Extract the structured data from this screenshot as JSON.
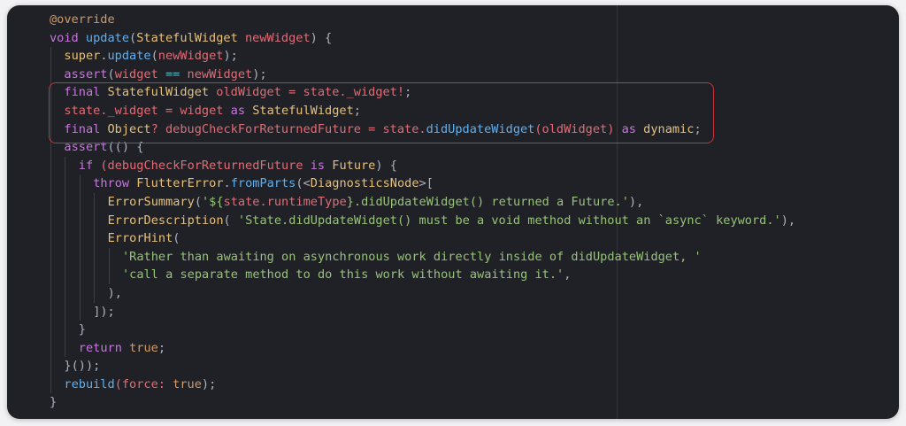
{
  "editor": {
    "highlight_color": "#c8333d",
    "lines": [
      {
        "indent": 0,
        "tokens": [
          {
            "t": "@override",
            "c": "ann"
          }
        ]
      },
      {
        "indent": 0,
        "tokens": [
          {
            "t": "void ",
            "c": "kw"
          },
          {
            "t": "update",
            "c": "fn"
          },
          {
            "t": "(",
            "c": "pl"
          },
          {
            "t": "StatefulWidget",
            "c": "ty"
          },
          {
            "t": " ",
            "c": "pl"
          },
          {
            "t": "newWidget",
            "c": "var"
          },
          {
            "t": ") {",
            "c": "pl"
          }
        ]
      },
      {
        "indent": 1,
        "tokens": [
          {
            "t": "super",
            "c": "ty"
          },
          {
            "t": ".",
            "c": "pl"
          },
          {
            "t": "update",
            "c": "fn"
          },
          {
            "t": "(",
            "c": "pl"
          },
          {
            "t": "newWidget",
            "c": "var"
          },
          {
            "t": ");",
            "c": "pl"
          }
        ]
      },
      {
        "indent": 1,
        "tokens": [
          {
            "t": "assert",
            "c": "kw"
          },
          {
            "t": "(",
            "c": "pl"
          },
          {
            "t": "widget",
            "c": "var"
          },
          {
            "t": " == ",
            "c": "op"
          },
          {
            "t": "newWidget",
            "c": "var"
          },
          {
            "t": ");",
            "c": "pl"
          }
        ]
      },
      {
        "indent": 1,
        "tokens": [
          {
            "t": "final ",
            "c": "kw"
          },
          {
            "t": "StatefulWidget",
            "c": "ty"
          },
          {
            "t": " oldWidget = ",
            "c": "var"
          },
          {
            "t": "state._widget!",
            "c": "var"
          },
          {
            "t": ";",
            "c": "pl"
          }
        ]
      },
      {
        "indent": 1,
        "tokens": [
          {
            "t": "state._widget = widget ",
            "c": "var"
          },
          {
            "t": "as ",
            "c": "kw"
          },
          {
            "t": "StatefulWidget",
            "c": "ty"
          },
          {
            "t": ";",
            "c": "pl"
          }
        ]
      },
      {
        "indent": 1,
        "tokens": [
          {
            "t": "final ",
            "c": "kw"
          },
          {
            "t": "Object",
            "c": "ty"
          },
          {
            "t": "? debugCheckForReturnedFuture = state.",
            "c": "var"
          },
          {
            "t": "didUpdateWidget",
            "c": "fn"
          },
          {
            "t": "(oldWidget) ",
            "c": "var"
          },
          {
            "t": "as ",
            "c": "kw"
          },
          {
            "t": "dynamic",
            "c": "ty"
          },
          {
            "t": ";",
            "c": "pl"
          }
        ]
      },
      {
        "indent": 1,
        "tokens": [
          {
            "t": "assert",
            "c": "kw"
          },
          {
            "t": "(() {",
            "c": "pl"
          }
        ]
      },
      {
        "indent": 2,
        "tokens": [
          {
            "t": "if ",
            "c": "kw"
          },
          {
            "t": "(debugCheckForReturnedFuture ",
            "c": "var"
          },
          {
            "t": "is ",
            "c": "kw"
          },
          {
            "t": "Future",
            "c": "ty"
          },
          {
            "t": ") {",
            "c": "pl"
          }
        ]
      },
      {
        "indent": 3,
        "tokens": [
          {
            "t": "throw ",
            "c": "kw"
          },
          {
            "t": "FlutterError",
            "c": "ty"
          },
          {
            "t": ".",
            "c": "pl"
          },
          {
            "t": "fromParts",
            "c": "fn"
          },
          {
            "t": "(<",
            "c": "pl"
          },
          {
            "t": "DiagnosticsNode",
            "c": "ty"
          },
          {
            "t": ">[",
            "c": "pl"
          }
        ]
      },
      {
        "indent": 4,
        "tokens": [
          {
            "t": "ErrorSummary",
            "c": "ty"
          },
          {
            "t": "(",
            "c": "pl"
          },
          {
            "t": "'${",
            "c": "str"
          },
          {
            "t": "state.runtimeType",
            "c": "var"
          },
          {
            "t": "}.didUpdateWidget() returned a Future.'",
            "c": "str"
          },
          {
            "t": "),",
            "c": "pl"
          }
        ]
      },
      {
        "indent": 4,
        "tokens": [
          {
            "t": "ErrorDescription",
            "c": "ty"
          },
          {
            "t": "( ",
            "c": "pl"
          },
          {
            "t": "'State.didUpdateWidget() must be a void method without an `async` keyword.'",
            "c": "str"
          },
          {
            "t": "),",
            "c": "pl"
          }
        ]
      },
      {
        "indent": 4,
        "tokens": [
          {
            "t": "ErrorHint",
            "c": "ty"
          },
          {
            "t": "(",
            "c": "pl"
          }
        ]
      },
      {
        "indent": 5,
        "tokens": [
          {
            "t": "'Rather than awaiting on asynchronous work directly inside of didUpdateWidget, '",
            "c": "str"
          }
        ]
      },
      {
        "indent": 5,
        "tokens": [
          {
            "t": "'call a separate method to do this work without awaiting it.'",
            "c": "str"
          },
          {
            "t": ",",
            "c": "pl"
          }
        ]
      },
      {
        "indent": 4,
        "tokens": [
          {
            "t": "),",
            "c": "pl"
          }
        ]
      },
      {
        "indent": 3,
        "tokens": [
          {
            "t": "]);",
            "c": "pl"
          }
        ]
      },
      {
        "indent": 2,
        "tokens": [
          {
            "t": "}",
            "c": "pl"
          }
        ]
      },
      {
        "indent": 2,
        "tokens": [
          {
            "t": "return ",
            "c": "kw"
          },
          {
            "t": "true",
            "c": "ann"
          },
          {
            "t": ";",
            "c": "pl"
          }
        ]
      },
      {
        "indent": 1,
        "tokens": [
          {
            "t": "}());",
            "c": "pl"
          }
        ]
      },
      {
        "indent": 1,
        "tokens": [
          {
            "t": "rebuild",
            "c": "fn"
          },
          {
            "t": "(force: ",
            "c": "var"
          },
          {
            "t": "true",
            "c": "ann"
          },
          {
            "t": ");",
            "c": "pl"
          }
        ]
      },
      {
        "indent": 0,
        "tokens": [
          {
            "t": "}",
            "c": "pl"
          }
        ]
      }
    ]
  }
}
